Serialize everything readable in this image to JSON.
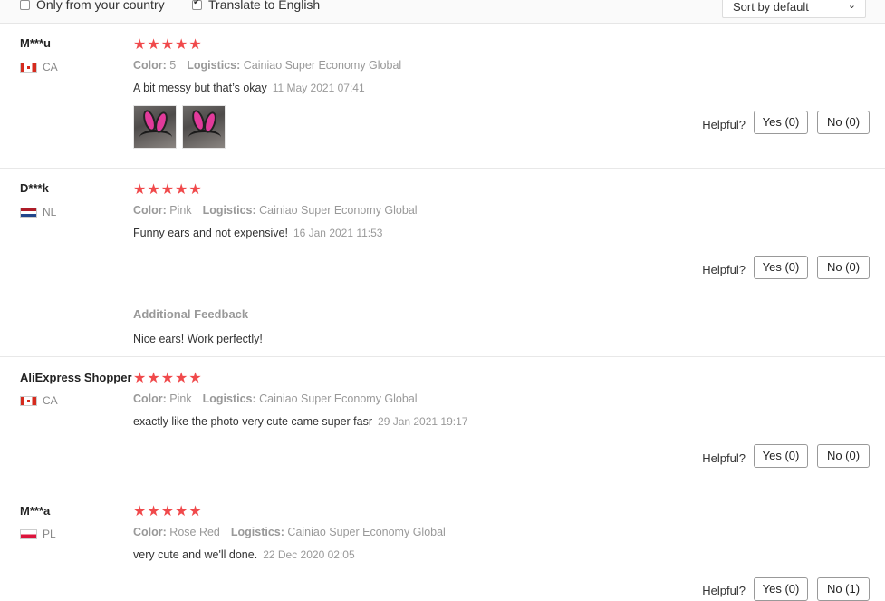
{
  "filters": {
    "only_country_label": "Only from your country",
    "only_country_checked": false,
    "translate_label": "Translate to English",
    "translate_checked": true,
    "sort_label": "Sort by default"
  },
  "helpful_label": "Helpful?",
  "labels": {
    "color": "Color:",
    "logistics": "Logistics:"
  },
  "stars": "★★★★★",
  "reviews": [
    {
      "user": "M***u",
      "country": "CA",
      "rating": 5,
      "color": "5",
      "logistics": "Cainiao Super Economy Global",
      "text": "A bit messy but that’s okay",
      "date": "11 May 2021 07:41",
      "yes": "Yes (0)",
      "no": "No (0)"
    },
    {
      "user": "D***k",
      "country": "NL",
      "rating": 5,
      "color": "Pink",
      "logistics": "Cainiao Super Economy Global",
      "text": "Funny ears and not expensive!",
      "date": "16 Jan 2021 11:53",
      "yes": "Yes (0)",
      "no": "No (0)",
      "additional_title": "Additional Feedback",
      "additional_text": "Nice ears! Work perfectly!"
    },
    {
      "user": "AliExpress Shopper",
      "country": "CA",
      "rating": 5,
      "color": "Pink",
      "logistics": "Cainiao Super Economy Global",
      "text": "exactly like the photo very cute came super fasr",
      "date": "29 Jan 2021 19:17",
      "yes": "Yes (0)",
      "no": "No (0)"
    },
    {
      "user": "M***a",
      "country": "PL",
      "rating": 5,
      "color": "Rose Red",
      "logistics": "Cainiao Super Economy Global",
      "text": "very cute and we'll done.",
      "date": "22 Dec 2020 02:05",
      "yes": "Yes (0)",
      "no": "No (1)"
    }
  ]
}
